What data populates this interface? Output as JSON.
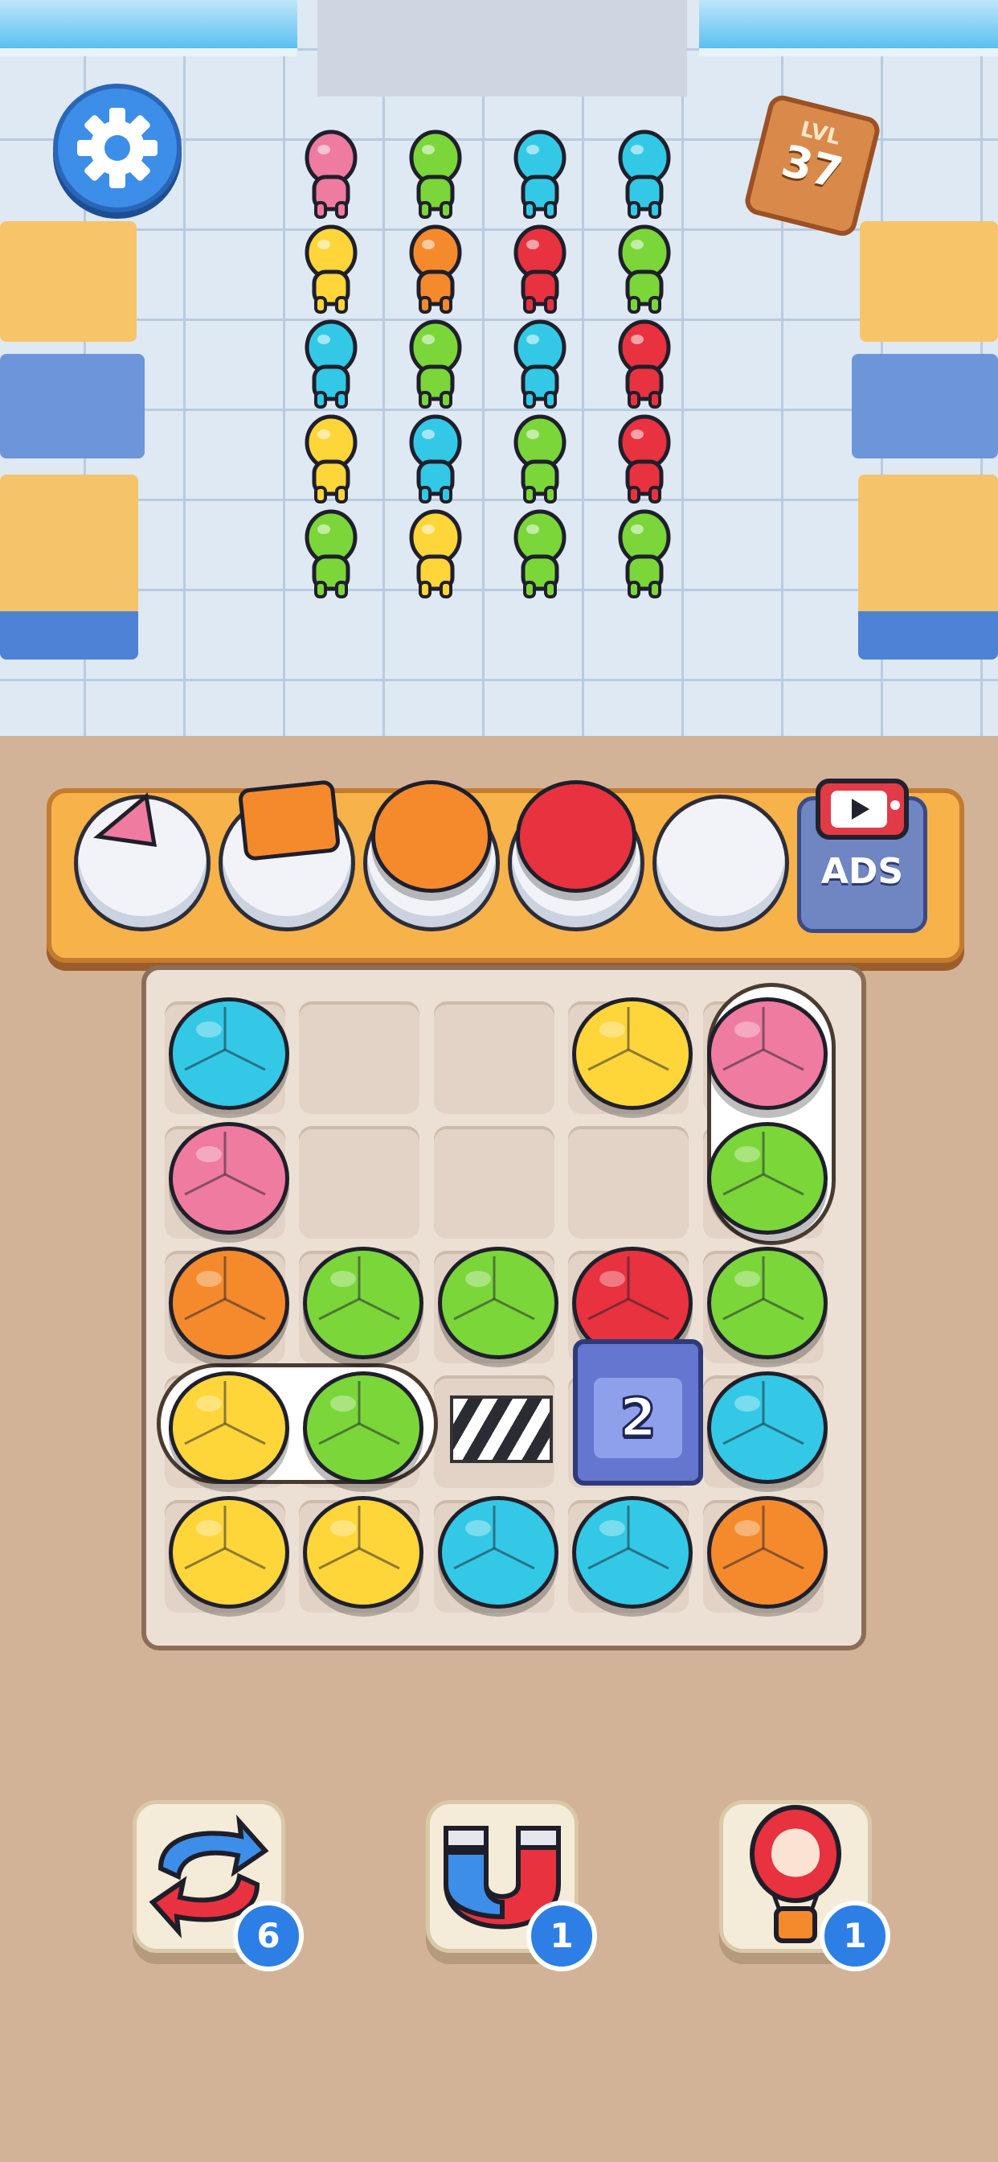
{
  "hud": {
    "settings_icon": "gear-icon",
    "level_label": "LVL",
    "level_number": "37"
  },
  "tray": {
    "slots": [
      {
        "content": "pink-cake-slice"
      },
      {
        "content": "orange-square-cake"
      },
      {
        "content": "orange-round-cake"
      },
      {
        "content": "red-round-cake"
      },
      {
        "content": "empty"
      }
    ],
    "ads_label": "ADS",
    "ads_icon": "tv-play-icon"
  },
  "queue": {
    "columns": [
      [
        "pink",
        "yellow",
        "cyan",
        "yellow",
        "green"
      ],
      [
        "green",
        "orange",
        "green",
        "cyan",
        "yellow"
      ],
      [
        "cyan",
        "red",
        "cyan",
        "green",
        "green"
      ],
      [
        "cyan",
        "green",
        "red",
        "red",
        "green"
      ]
    ]
  },
  "board": {
    "locked_box_count": "2",
    "colors": {
      "cyan": "#33c9e6",
      "pink": "#f07ba0",
      "orange": "#f58a2d",
      "green": "#7bd63a",
      "red": "#e8323f",
      "yellow": "#ffd63a"
    }
  },
  "boosters": [
    {
      "name": "shuffle",
      "icon": "shuffle-arrows-icon",
      "count": "6"
    },
    {
      "name": "magnet",
      "icon": "magnet-icon",
      "count": "1"
    },
    {
      "name": "balloon",
      "icon": "hot-air-balloon-icon",
      "count": "1"
    }
  ]
}
